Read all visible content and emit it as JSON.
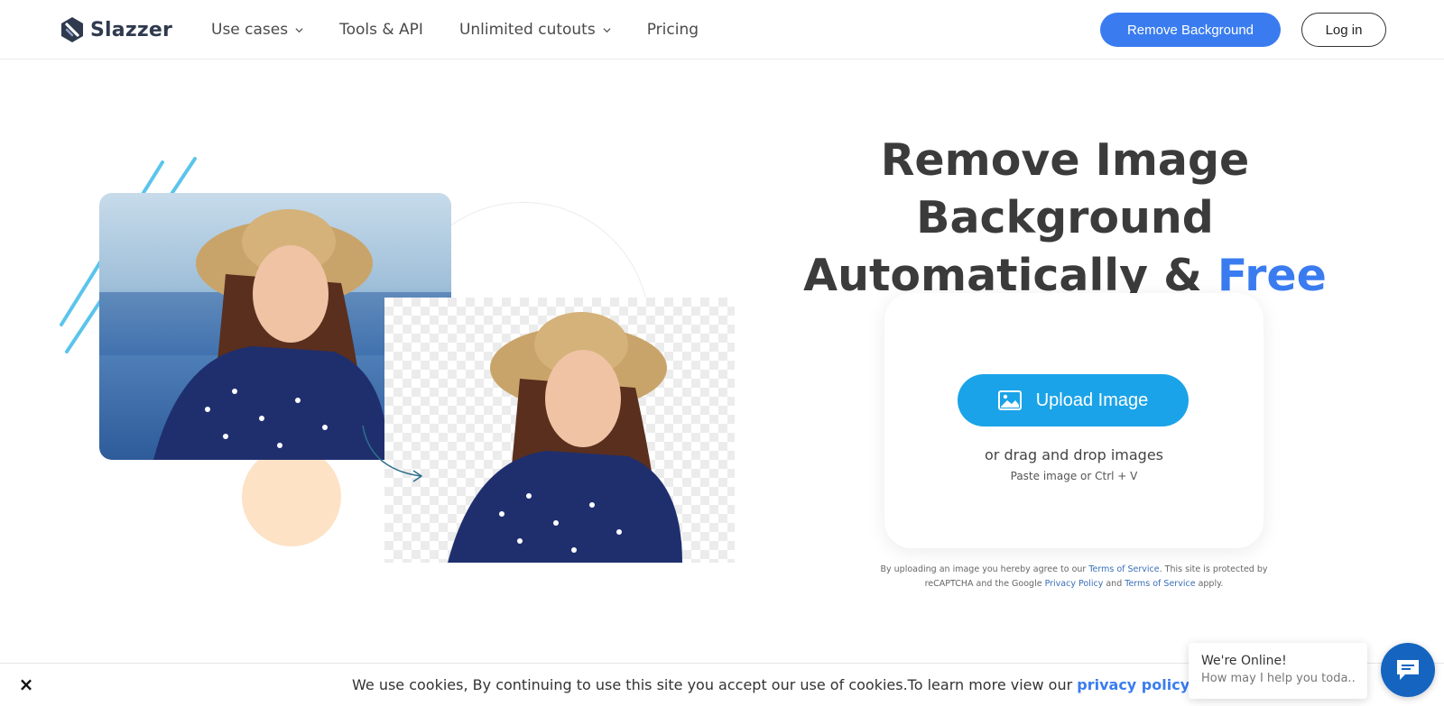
{
  "brand": {
    "name": "Slazzer"
  },
  "nav": {
    "items": [
      {
        "label": "Use cases",
        "dropdown": true
      },
      {
        "label": "Tools & API",
        "dropdown": false
      },
      {
        "label": "Unlimited cutouts",
        "dropdown": true
      },
      {
        "label": "Pricing",
        "dropdown": false
      }
    ],
    "cta_label": "Remove Background",
    "login_label": "Log in"
  },
  "hero": {
    "title_line1": "Remove Image Background",
    "title_line2_prefix": "Automatically & ",
    "title_line2_highlight": "Free"
  },
  "upload": {
    "button_label": "Upload Image",
    "drag_text": "or drag and drop images",
    "paste_text": "Paste image or Ctrl + V"
  },
  "terms": {
    "part1": "By uploading an image you hereby agree to our ",
    "link1": "Terms of Service",
    "part2": ". This site is protected by reCAPTCHA and the Google ",
    "link2": "Privacy Policy",
    "part3": " and ",
    "link3": "Terms of Service",
    "part4": " apply."
  },
  "cookie": {
    "close_label": "×",
    "text": "We use cookies, By continuing to use this site you accept our use of cookies.To learn more view our ",
    "link": "privacy policy."
  },
  "chat": {
    "title": "We're Online!",
    "subtitle": "How may I help you toda..."
  },
  "colors": {
    "accent": "#3a7cf0",
    "upload_button": "#1aa3e8",
    "chat_button": "#1565c0",
    "peach": "#fde2c6",
    "stripes": "#5bc4ec"
  }
}
